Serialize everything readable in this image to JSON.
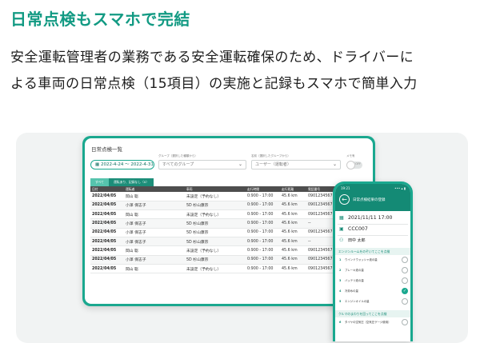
{
  "headline": "日常点検もスマホで完結",
  "lead_lines": [
    "安全運転管理者の業務である安全運転確保のため、ドライバーに",
    "よる車両の日常点検（15項目）の実施と記録もスマホで簡単入力"
  ],
  "colors": {
    "accent": "#1aa88f",
    "accent_dark": "#148a75",
    "headline": "#129a83"
  },
  "tablet": {
    "title": "日常点検一覧",
    "date_range": "2022-4-24 〜 2022-4-31",
    "group_label": "グループ（選択した種類から）",
    "group_value": "すべてのグループ",
    "name_label": "名前（選択したグループから）",
    "name_placeholder": "ユーザー（運転者）",
    "memo_label": "メモ有",
    "toggle_label": "OFF",
    "tabs": [
      "すべて",
      "運転あり、記録なし（0）"
    ],
    "columns": [
      "日付",
      "運転者",
      "車両",
      "走行時間",
      "走行距離",
      "電話番号"
    ],
    "rows": [
      [
        "2022/04/05",
        "岡山 聡",
        "未設定（予約なし）",
        "0:900 - 17:00",
        "45.6 km",
        "0901234567"
      ],
      [
        "2022/04/05",
        "小澤 保志子",
        "5D 杉山康宗",
        "0:900 - 17:00",
        "45.6 km",
        "0901234567"
      ],
      [
        "2022/04/05",
        "岡山 聡",
        "未設定（予約なし）",
        "0:900 - 17:00",
        "45.6 km",
        "0901234567"
      ],
      [
        "2022/04/05",
        "小澤 保志子",
        "5D 杉山康宗",
        "0:900 - 17:00",
        "45.6 km",
        "--"
      ],
      [
        "2022/04/05",
        "小澤 保志子",
        "5D 杉山康宗",
        "0:900 - 17:00",
        "45.6 km",
        "0901234567"
      ],
      [
        "2022/04/05",
        "小澤 保志子",
        "5D 杉山康宗",
        "0:900 - 17:00",
        "45.6 km",
        "--"
      ],
      [
        "2022/04/05",
        "岡山 聡",
        "未設定（予約なし）",
        "0:900 - 17:00",
        "45.6 km",
        "0901234567"
      ],
      [
        "2022/04/05",
        "小澤 保志子",
        "5D 杉山康宗",
        "0:900 - 17:00",
        "45.6 km",
        "0901234567"
      ],
      [
        "2022/04/05",
        "岡山 聡",
        "未設定（予約なし）",
        "0:900 - 17:00",
        "45.6 km",
        "0901234567"
      ]
    ]
  },
  "phone": {
    "time": "19:21",
    "status": "••• ▴ ▮",
    "header_title": "日常点検結果の登録",
    "datetime": "2021/11/11 17:00",
    "car": "CCC007",
    "driver": "田中 太郎",
    "section1": "エンジンルームをのぞいてここを点検",
    "items": [
      {
        "num": "1",
        "label": "ウインドウォッシャ液の量",
        "done": false
      },
      {
        "num": "2",
        "label": "ブレーキ液の量",
        "done": false
      },
      {
        "num": "3",
        "label": "バッテリ液の量",
        "done": false
      },
      {
        "num": "4",
        "label": "冷却水の量",
        "done": true
      },
      {
        "num": "5",
        "label": "エンジンオイルの量",
        "done": false
      }
    ],
    "section2": "クルマのまわりを回ってここを点検",
    "items2": [
      {
        "num": "6",
        "label": "タイヤの空気圧（空気圧ゲージ使用）",
        "done": false
      }
    ]
  }
}
